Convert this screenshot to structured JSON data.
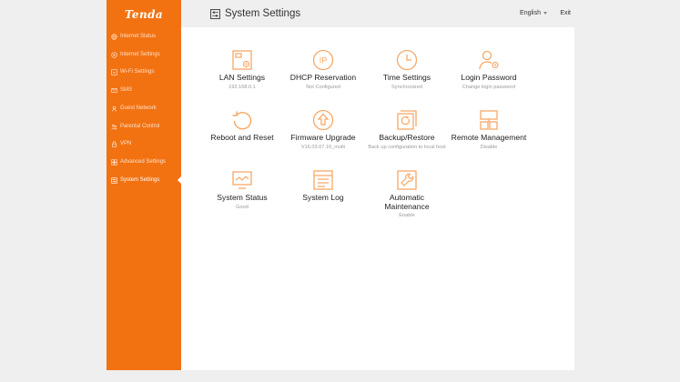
{
  "brand": {
    "logo_text": "Tenda",
    "accent": "#f27212"
  },
  "sidebar": {
    "items": [
      {
        "label": "Internet Status",
        "icon": "globe-icon"
      },
      {
        "label": "Internet Settings",
        "icon": "globe-settings-icon"
      },
      {
        "label": "Wi-Fi Settings",
        "icon": "wifi-icon"
      },
      {
        "label": "SMS",
        "icon": "sms-icon"
      },
      {
        "label": "Guest Network",
        "icon": "guest-icon"
      },
      {
        "label": "Parental Control",
        "icon": "parental-icon"
      },
      {
        "label": "VPN",
        "icon": "vpn-icon"
      },
      {
        "label": "Advanced Settings",
        "icon": "advanced-icon"
      },
      {
        "label": "System Settings",
        "icon": "system-settings-icon",
        "active": true
      }
    ]
  },
  "header": {
    "title": "System Settings",
    "language": "English",
    "exit_label": "Exit"
  },
  "tiles": [
    {
      "label": "LAN Settings",
      "sub": "192.168.0.1",
      "icon": "lan-icon"
    },
    {
      "label": "DHCP Reservation",
      "sub": "Not Configured",
      "icon": "ip-icon"
    },
    {
      "label": "Time Settings",
      "sub": "Synchronized",
      "icon": "clock-icon"
    },
    {
      "label": "Login Password",
      "sub": "Change login password",
      "icon": "user-lock-icon"
    },
    {
      "label": "Reboot and Reset",
      "sub": "",
      "icon": "reboot-icon"
    },
    {
      "label": "Firmware Upgrade",
      "sub": "V16.03.07.10_multi",
      "icon": "upgrade-icon"
    },
    {
      "label": "Backup/Restore",
      "sub": "Back up configuration to local host",
      "icon": "backup-icon"
    },
    {
      "label": "Remote Management",
      "sub": "Disable",
      "icon": "remote-icon"
    },
    {
      "label": "System Status",
      "sub": "Good",
      "icon": "monitor-icon"
    },
    {
      "label": "System Log",
      "sub": "",
      "icon": "log-icon"
    },
    {
      "label": "Automatic Maintenance",
      "sub": "Enable",
      "icon": "wrench-icon"
    }
  ]
}
